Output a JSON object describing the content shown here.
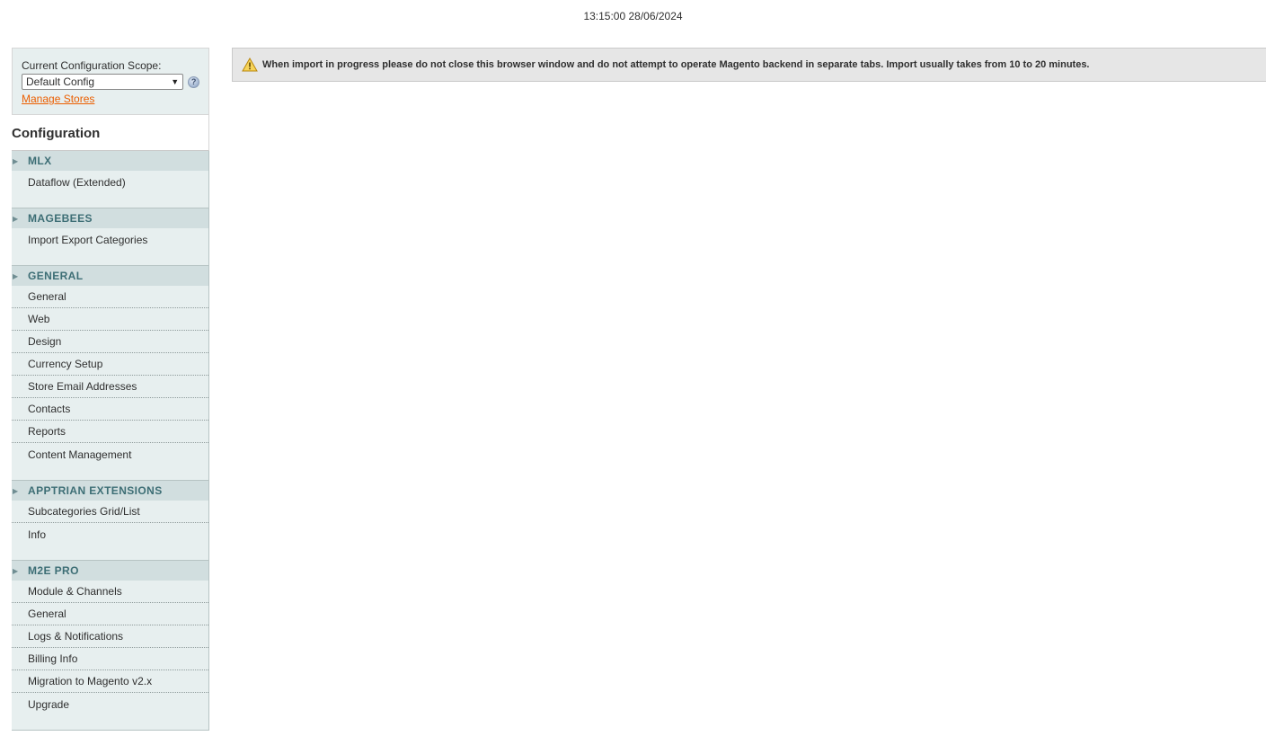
{
  "header": {
    "timestamp": "13:15:00 28/06/2024"
  },
  "scope": {
    "label": "Current Configuration Scope:",
    "selected": "Default Config",
    "help_icon": "help-icon",
    "manage_stores": "Manage Stores"
  },
  "config": {
    "title": "Configuration"
  },
  "sections": [
    {
      "title": "MLX",
      "items": [
        "Dataflow (Extended)"
      ]
    },
    {
      "title": "MAGEBEES",
      "items": [
        "Import Export Categories"
      ]
    },
    {
      "title": "GENERAL",
      "items": [
        "General",
        "Web",
        "Design",
        "Currency Setup",
        "Store Email Addresses",
        "Contacts",
        "Reports",
        "Content Management"
      ]
    },
    {
      "title": "APPTRIAN EXTENSIONS",
      "items": [
        "Subcategories Grid/List",
        "Info"
      ]
    },
    {
      "title": "M2E PRO",
      "items": [
        "Module & Channels",
        "General",
        "Logs & Notifications",
        "Billing Info",
        "Migration to Magento v2.x",
        "Upgrade"
      ]
    }
  ],
  "notice": {
    "icon": "warning-icon",
    "text": "When import in progress please do not close this browser window and do not attempt to operate Magento backend in separate tabs. Import usually takes from 10 to 20 minutes."
  },
  "colors": {
    "link": "#eb5e00",
    "section_header_bg": "#d1dedf",
    "section_header_text": "#3d6e75",
    "sidebar_bg": "#e7efef"
  }
}
